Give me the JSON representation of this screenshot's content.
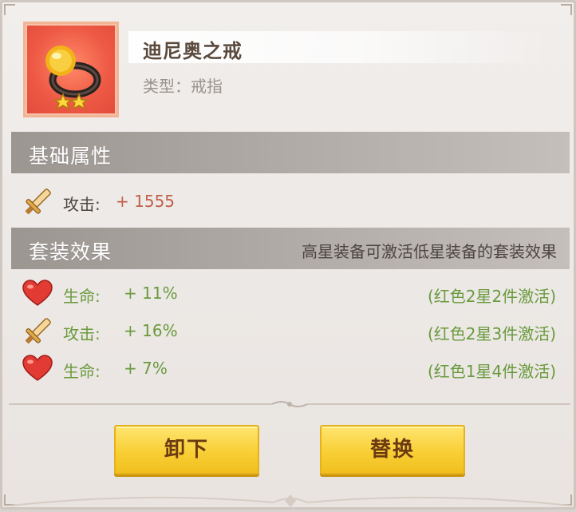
{
  "item": {
    "name": "迪尼奥之戒",
    "type_label": "类型：",
    "type_value": "戒指",
    "stars": 2,
    "icon": "gold-ring-icon"
  },
  "base_section": {
    "title": "基础属性",
    "stats": [
      {
        "icon": "sword-icon",
        "label": "攻击:",
        "value": "+ 1555"
      }
    ]
  },
  "set_section": {
    "title": "套装效果",
    "note": "高星装备可激活低星装备的套装效果",
    "effects": [
      {
        "icon": "heart-icon",
        "label": "生命:",
        "value": "+ 11%",
        "condition": "(红色2星2件激活)"
      },
      {
        "icon": "sword-icon",
        "label": "攻击:",
        "value": "+ 16%",
        "condition": "(红色2星3件激活)"
      },
      {
        "icon": "heart-icon",
        "label": "生命:",
        "value": "+ 7%",
        "condition": "(红色1星4件激活)"
      }
    ]
  },
  "buttons": {
    "unequip": "卸下",
    "replace": "替换"
  },
  "colors": {
    "frame_red": "#ee5a45",
    "button_gold": "#f8cf35",
    "set_green": "#6a9a3e",
    "attack_value_red": "#c0604a"
  }
}
